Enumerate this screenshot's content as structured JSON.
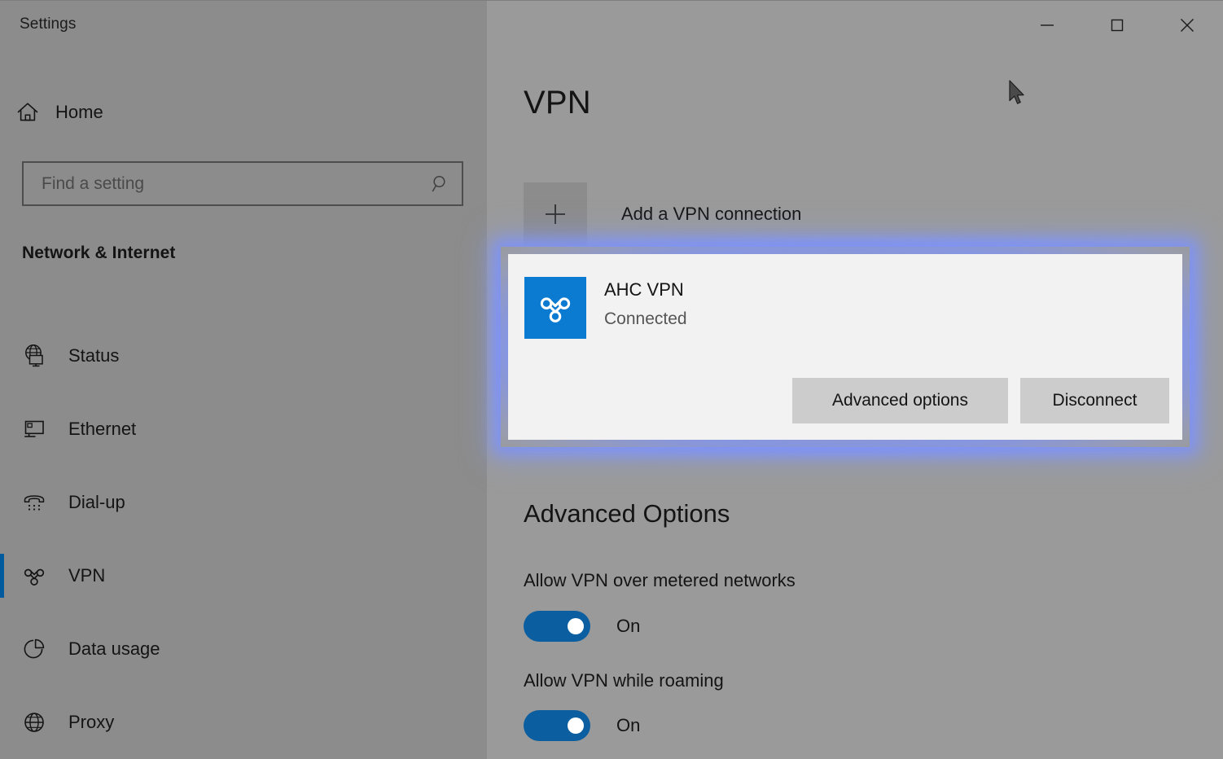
{
  "window": {
    "title": "Settings",
    "controls": {
      "minimize_label": "Minimize",
      "maximize_label": "Maximize",
      "close_label": "Close"
    }
  },
  "sidebar": {
    "home": {
      "label": "Home",
      "icon": "home-icon"
    },
    "search": {
      "placeholder": "Find a setting",
      "value": "",
      "icon": "search-icon"
    },
    "category": "Network & Internet",
    "items": [
      {
        "label": "Status",
        "icon": "globe-monitor-icon",
        "selected": false
      },
      {
        "label": "Ethernet",
        "icon": "ethernet-icon",
        "selected": false
      },
      {
        "label": "Dial-up",
        "icon": "dialup-phone-icon",
        "selected": false
      },
      {
        "label": "VPN",
        "icon": "vpn-knot-icon",
        "selected": true
      },
      {
        "label": "Data usage",
        "icon": "pie-chart-icon",
        "selected": false
      },
      {
        "label": "Proxy",
        "icon": "globe-icon",
        "selected": false
      }
    ]
  },
  "main": {
    "page_title": "VPN",
    "add_connection": {
      "label": "Add a VPN connection",
      "icon": "plus-icon"
    },
    "connection": {
      "name": "AHC VPN",
      "status": "Connected",
      "icon": "vpn-knot-icon",
      "highlighted": true,
      "buttons": {
        "advanced_options": "Advanced options",
        "disconnect": "Disconnect"
      }
    },
    "advanced_options": {
      "heading": "Advanced Options",
      "settings": [
        {
          "label": "Allow VPN over metered networks",
          "state": "On"
        },
        {
          "label": "Allow VPN while roaming",
          "state": "On"
        }
      ]
    }
  },
  "colors": {
    "accent_blue": "#0b5fa0",
    "vpn_tile_blue": "#0b7ad1",
    "selection_bar": "#005a9e",
    "glow": "#7d91f3",
    "sidebar_bg": "#8c8c8c",
    "content_bg": "#9a9a9a",
    "card_bg": "#f2f2f2",
    "button_bg": "#cccccc"
  }
}
